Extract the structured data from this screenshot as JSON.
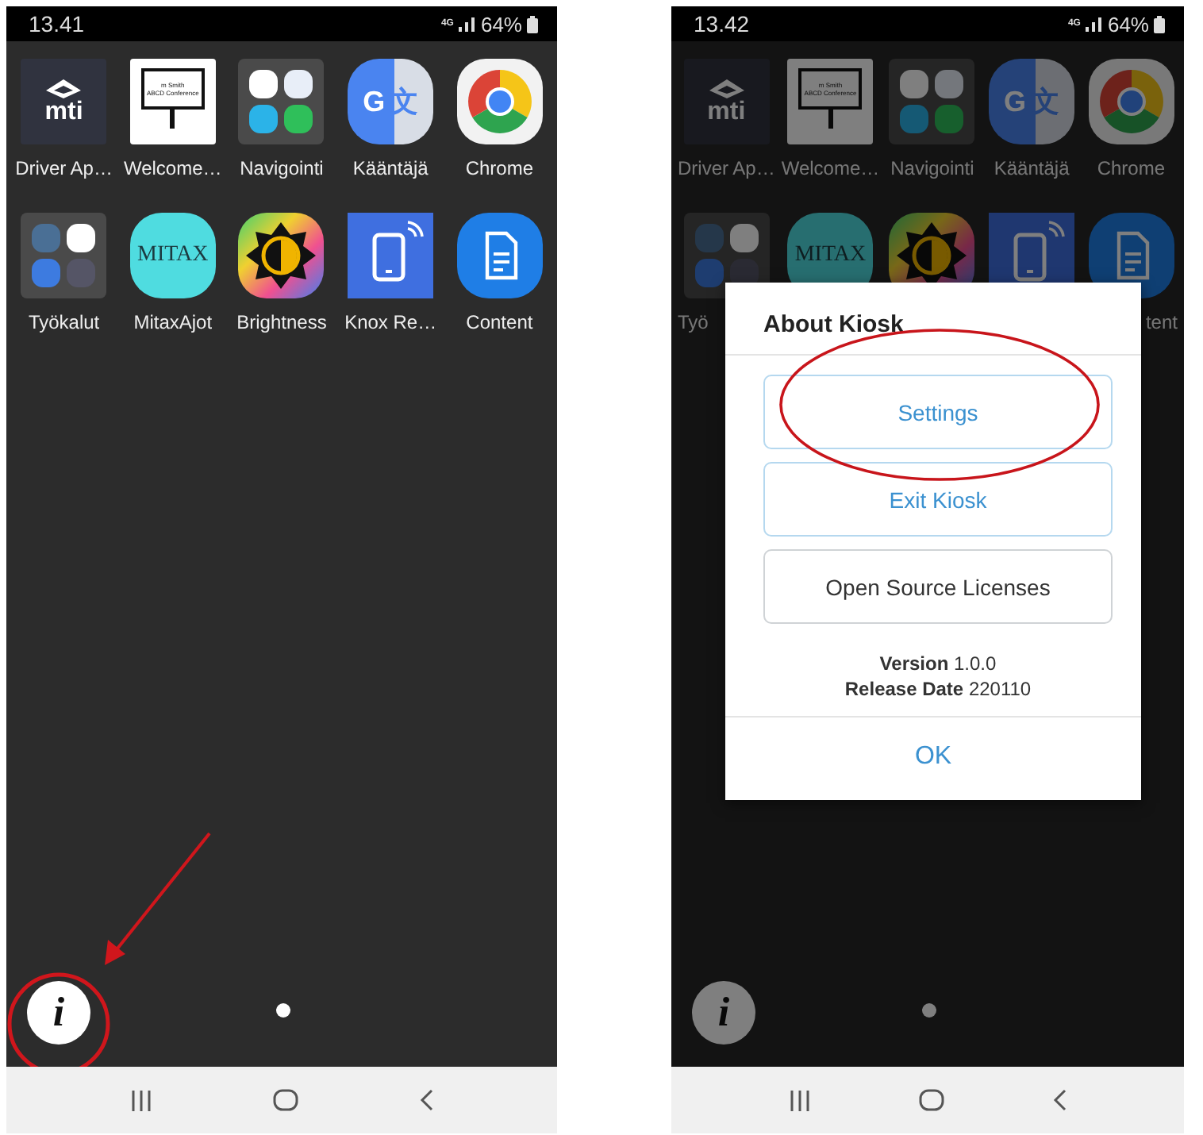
{
  "screens": [
    {
      "time": "13.41",
      "network": "4G",
      "battery": "64%",
      "dimmed": false,
      "apps": [
        {
          "label": "Driver Ap…",
          "kind": "mti",
          "icon_text": [
            "mti"
          ]
        },
        {
          "label": "Welcome…",
          "kind": "sign",
          "icon_text": [
            "m Smith",
            "ABCD Conference"
          ]
        },
        {
          "label": "Navigointi",
          "kind": "nav-folder"
        },
        {
          "label": "Kääntäjä",
          "kind": "translate",
          "icon_text": [
            "G",
            "文"
          ]
        },
        {
          "label": "Chrome",
          "kind": "chrome"
        },
        {
          "label": "Työkalut",
          "kind": "tools-folder"
        },
        {
          "label": "MitaxAjot",
          "kind": "mitax",
          "icon_text": [
            "MITAX"
          ]
        },
        {
          "label": "Brightness",
          "kind": "brightness"
        },
        {
          "label": "Knox Re…",
          "kind": "knox"
        },
        {
          "label": "Content",
          "kind": "content"
        }
      ],
      "info_button": {
        "label": "i"
      }
    },
    {
      "time": "13.42",
      "network": "4G",
      "battery": "64%",
      "dimmed": true,
      "apps": [
        {
          "label": "Driver Ap…",
          "kind": "mti",
          "icon_text": [
            "mti"
          ]
        },
        {
          "label": "Welcome…",
          "kind": "sign",
          "icon_text": [
            "m Smith",
            "ABCD Conference"
          ]
        },
        {
          "label": "Navigointi",
          "kind": "nav-folder"
        },
        {
          "label": "Kääntäjä",
          "kind": "translate",
          "icon_text": [
            "G",
            "文"
          ]
        },
        {
          "label": "Chrome",
          "kind": "chrome"
        },
        {
          "label": "Työ",
          "kind": "tools-folder"
        },
        {
          "kind": "mitax",
          "icon_text": [
            "MITAX"
          ]
        },
        {
          "kind": "brightness"
        },
        {
          "kind": "knox"
        },
        {
          "label": "tent",
          "kind": "content"
        }
      ],
      "info_button": {
        "label": "i"
      },
      "dialog": {
        "title": "About Kiosk",
        "buttons": [
          {
            "label": "Settings",
            "kind": "primary"
          },
          {
            "label": "Exit Kiosk",
            "kind": "primary"
          },
          {
            "label": "Open Source Licenses",
            "kind": "plain"
          }
        ],
        "info": [
          "**Version** 1.0.0",
          "**Release Date** 220110"
        ],
        "ok": "OK"
      }
    }
  ]
}
